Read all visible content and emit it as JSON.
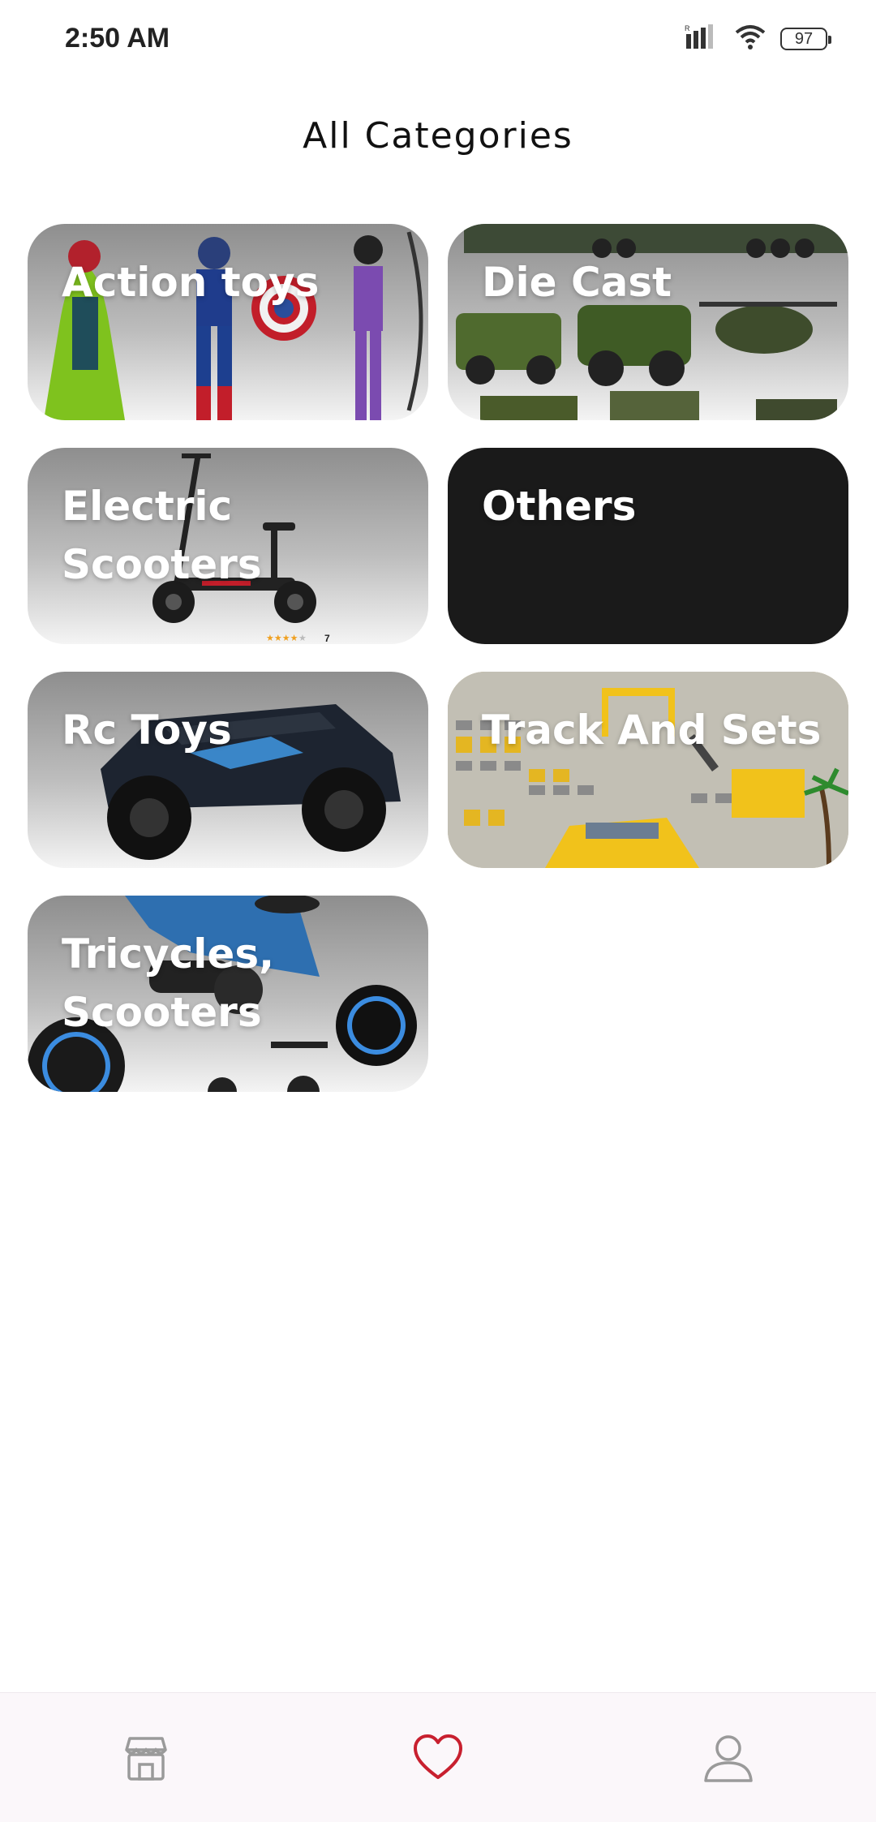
{
  "status_bar": {
    "time": "2:50 AM",
    "battery": "97",
    "icons": [
      "signal-icon",
      "wifi-icon",
      "battery-icon"
    ]
  },
  "header": {
    "title": "All Categories"
  },
  "categories": [
    {
      "label": "Action toys",
      "image": "action-figures"
    },
    {
      "label": "Die Cast",
      "image": "die-cast-vehicles"
    },
    {
      "label": "Electric Scooters",
      "image": "electric-scooter",
      "rating_count": "7"
    },
    {
      "label": "Others",
      "image": "none"
    },
    {
      "label": "Rc Toys",
      "image": "rc-truck"
    },
    {
      "label": "Track And Sets",
      "image": "track-set"
    },
    {
      "label": "Tricycles, Scooters",
      "image": "tricycle"
    }
  ],
  "bottom_nav": {
    "items": [
      {
        "icon": "store-icon"
      },
      {
        "icon": "heart-icon",
        "active": true
      },
      {
        "icon": "user-icon"
      }
    ]
  },
  "colors": {
    "accent": "#c8202f",
    "nav_inactive": "#9a9a9a",
    "others_card": "#1a1a1a"
  }
}
